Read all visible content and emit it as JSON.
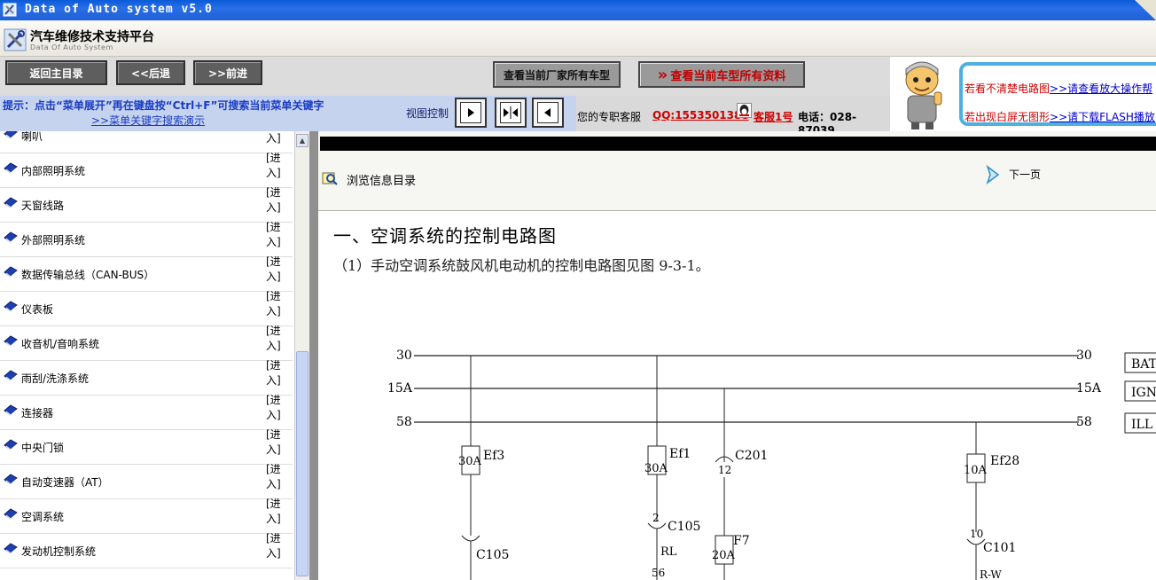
{
  "window": {
    "title": "Data of Auto system v5.0"
  },
  "brand": {
    "name": "汽车维修技术支持平台",
    "subtitle": "Data Of Auto System"
  },
  "toolbar": {
    "home_label": "返回主目录",
    "back_label": "<<后退",
    "forward_label": ">>前进",
    "all_vendor_models_label": "查看当前厂家所有车型",
    "all_model_data_label": "查看当前车型所有资料",
    "all_model_data_prefix": "»"
  },
  "hint": {
    "text": "提示：点击“菜单展开”再在键盘按“Ctrl+F”可搜索当前菜单关键字",
    "demo_link": ">>菜单关键字搜索演示"
  },
  "view_control": {
    "label": "视图控制"
  },
  "service": {
    "label": "您的专职客服",
    "qq": "QQ:1553501388",
    "agent": "客服1号",
    "phone": "电话：028-87039"
  },
  "help": {
    "line1_text": "若看不清楚电路图",
    "line1_link": ">>请查看放大操作帮",
    "line2_text": "若出现白屏无图形",
    "line2_link": ">>请下载FLASH播放"
  },
  "sidebar": {
    "enter_label": "[进入]",
    "items": [
      {
        "label": "喇叭"
      },
      {
        "label": "内部照明系统"
      },
      {
        "label": "天窗线路"
      },
      {
        "label": "外部照明系统"
      },
      {
        "label": "数据传输总线（CAN-BUS）"
      },
      {
        "label": "仪表板"
      },
      {
        "label": "收音机/音响系统"
      },
      {
        "label": "雨刮/洗涤系统"
      },
      {
        "label": "连接器"
      },
      {
        "label": "中央门锁"
      },
      {
        "label": "自动变速器（AT）"
      },
      {
        "label": "空调系统"
      },
      {
        "label": "发动机控制系统"
      }
    ]
  },
  "content": {
    "browse_label": "浏览信息目录",
    "next_label": "下一页",
    "heading": "一、空调系统的控制电路图",
    "paragraph": "（1）手动空调系统鼓风机电动机的控制电路图见图 9-3-1。"
  },
  "diagram": {
    "rails": [
      {
        "left": "30",
        "right": "30",
        "tag": "BAT"
      },
      {
        "left": "15A",
        "right": "15A",
        "tag": "IGN"
      },
      {
        "left": "58",
        "right": "58",
        "tag": "ILL"
      }
    ],
    "fuses": [
      {
        "name": "Ef3",
        "rating": "30A"
      },
      {
        "name": "Ef1",
        "rating": "30A"
      },
      {
        "name": "Ef28",
        "rating": "10A"
      },
      {
        "name": "F7",
        "rating": "20A"
      }
    ],
    "connectors": [
      {
        "name": "C201",
        "pin": "12"
      },
      {
        "name": "C105",
        "pin": ""
      },
      {
        "name": "C105",
        "pin": "2"
      },
      {
        "name": "C101",
        "pin": "10"
      }
    ],
    "wires": [
      "RL",
      "56",
      "R-W"
    ]
  }
}
